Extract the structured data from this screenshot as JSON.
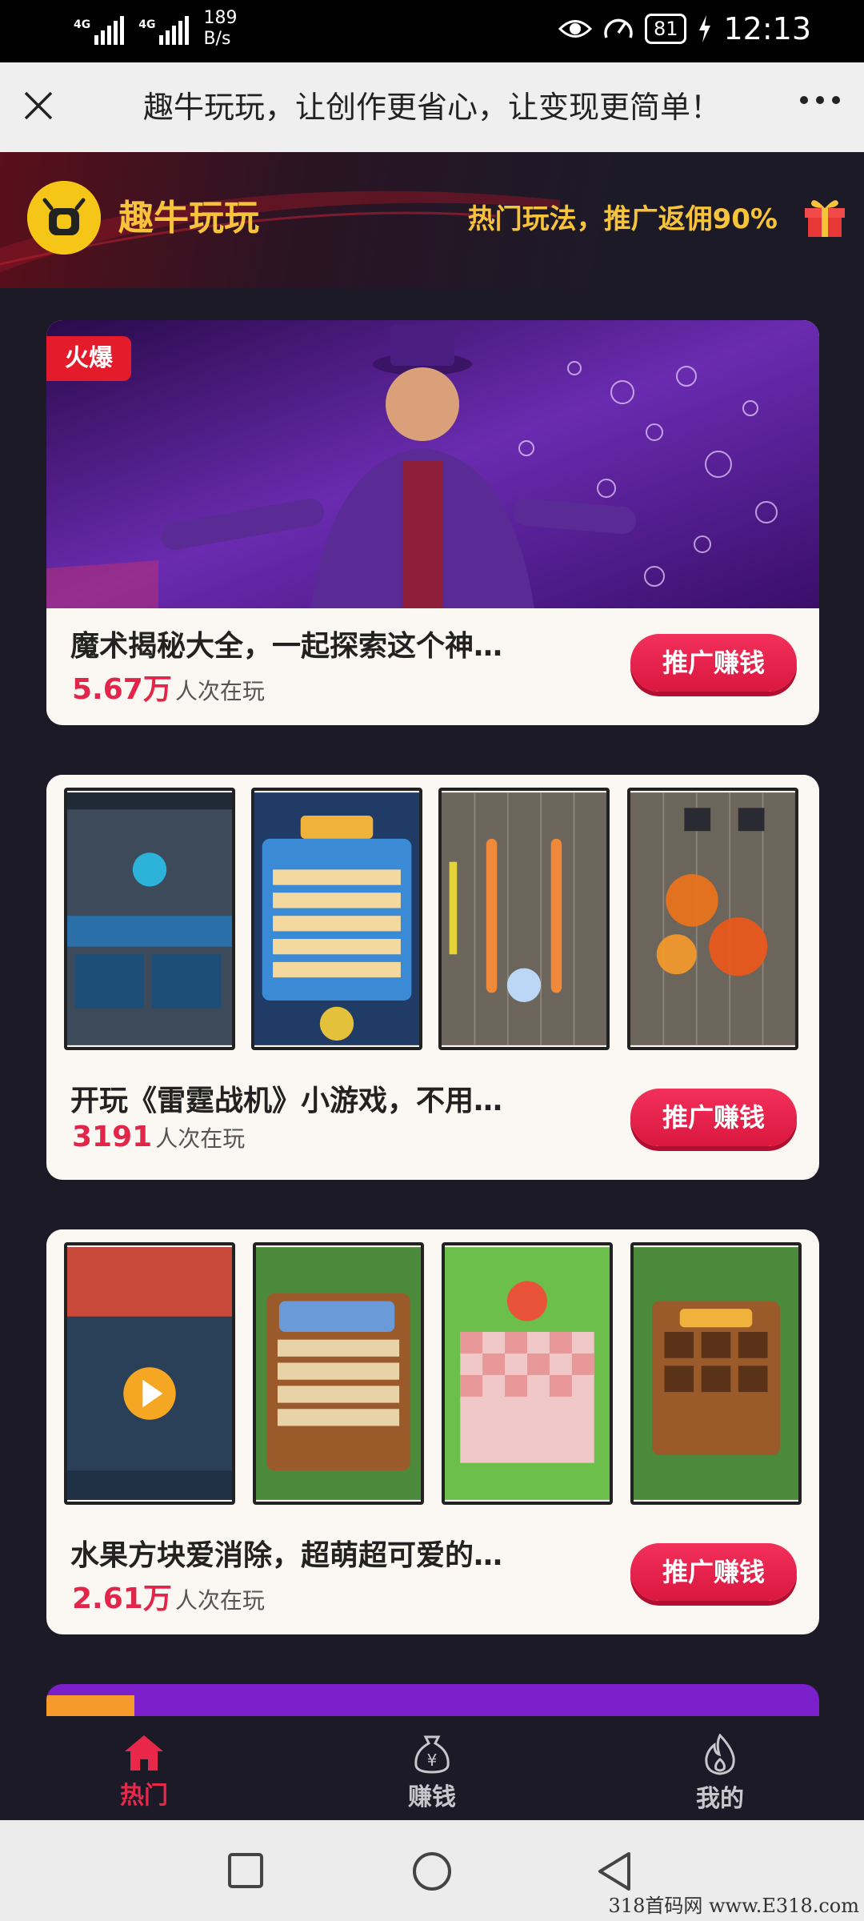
{
  "status_bar": {
    "network1": "4G",
    "network2": "4G",
    "speed_value": "189",
    "speed_unit": "B/s",
    "battery": "81",
    "time": "12:13"
  },
  "nav_bar": {
    "title": "趣牛玩玩，让创作更省心，让变现更简单！"
  },
  "brand": {
    "name": "趣牛玩玩",
    "slogan": "热门玩法，推广返佣90%"
  },
  "cards": [
    {
      "badge": "火爆",
      "title": "魔术揭秘大全，一起探索这个神…",
      "count": "5.67万",
      "count_suffix": "人次在玩",
      "button": "推广赚钱"
    },
    {
      "title": "开玩《雷霆战机》小游戏，不用…",
      "count": "3191",
      "count_suffix": "人次在玩",
      "button": "推广赚钱"
    },
    {
      "title": "水果方块爱消除，超萌超可爱的…",
      "count": "2.61万",
      "count_suffix": "人次在玩",
      "button": "推广赚钱"
    }
  ],
  "tabs": [
    {
      "label": "热门",
      "icon": "home-icon",
      "active": true
    },
    {
      "label": "赚钱",
      "icon": "money-bag-icon",
      "active": false
    },
    {
      "label": "我的",
      "icon": "flame-icon",
      "active": false
    }
  ],
  "watermark": "318首码网 www.E318.com",
  "colors": {
    "accent": "#e8274b",
    "gold": "#f7c33b",
    "background": "#1b1a26"
  }
}
